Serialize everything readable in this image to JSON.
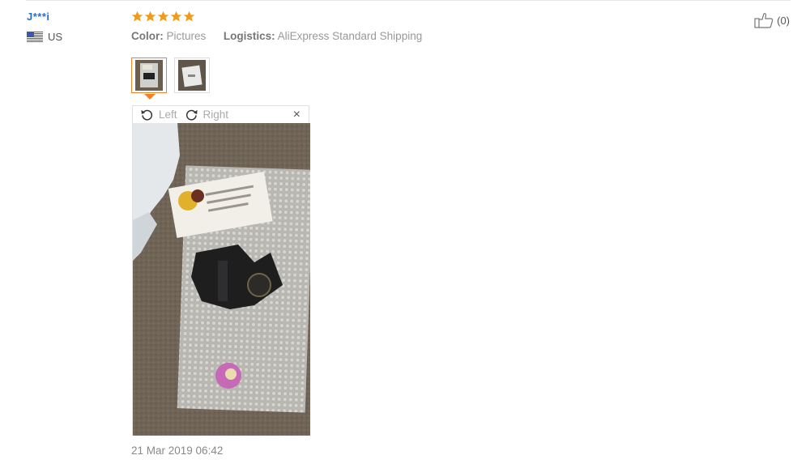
{
  "review": {
    "user_name": "J***i",
    "country": "US",
    "rating": 5,
    "rating_max": 5,
    "color_label": "Color:",
    "color_value": "Pictures",
    "logistics_label": "Logistics:",
    "logistics_value": "AliExpress Standard Shipping",
    "helpful_count": "(0)",
    "date": "21 Mar 2019 06:42"
  },
  "viewer": {
    "rotate_left": "Left",
    "rotate_right": "Right",
    "close": "×"
  },
  "colors": {
    "star": "#f39a1b",
    "accent": "#f0832a",
    "username": "#2a6ec7"
  },
  "icons": [
    "us-flag-icon",
    "star-icon",
    "thumbs-up-icon",
    "rotate-left-icon",
    "rotate-right-icon",
    "close-icon"
  ]
}
